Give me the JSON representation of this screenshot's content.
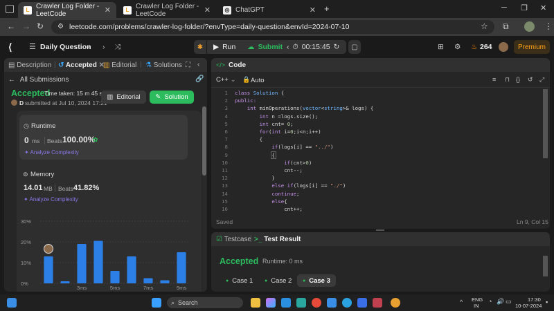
{
  "browser": {
    "tabs": [
      {
        "label": "Crawler Log Folder - LeetCode",
        "active": true
      },
      {
        "label": "Crawler Log Folder - LeetCode",
        "active": false
      },
      {
        "label": "ChatGPT",
        "active": false
      }
    ],
    "url": "leetcode.com/problems/crawler-log-folder/?envType=daily-question&envId=2024-07-10"
  },
  "header": {
    "daily_question": "Daily Question",
    "run": "Run",
    "submit": "Submit",
    "timer": "00:15:45",
    "streak": "264",
    "premium": "Premium"
  },
  "left_panel": {
    "tabs": [
      "Description",
      "Accepted",
      "Editorial",
      "Solutions"
    ],
    "all_submissions": "All Submissions",
    "status": "Accepted",
    "time_taken": "Time taken: 15 m 45 s",
    "user": "D",
    "submitted": "submitted at Jul 10, 2024 17:21",
    "editorial_btn": "Editorial",
    "solution_btn": "Solution",
    "runtime": {
      "title": "Runtime",
      "value": "0",
      "unit": "ms",
      "beats_label": "Beats",
      "beats_value": "100.00%",
      "analyze": "Analyze Complexity"
    },
    "memory": {
      "title": "Memory",
      "value": "14.01",
      "unit": "MB",
      "beats_label": "Beats",
      "beats_value": "41.82%",
      "analyze": "Analyze Complexity"
    }
  },
  "chart_data": {
    "type": "bar",
    "ytick_labels": [
      "30%",
      "20%",
      "10%",
      "0%"
    ],
    "ylim": [
      0,
      30
    ],
    "xtick_labels": [
      "3ms",
      "5ms",
      "7ms",
      "9ms"
    ],
    "values": [
      13,
      1,
      19,
      20.5,
      6,
      13,
      2.5,
      1.5,
      15
    ]
  },
  "code_panel": {
    "title": "Code",
    "language": "C++",
    "mode": "Auto",
    "saved": "Saved",
    "cursor": "Ln 9, Col 15",
    "lines": [
      "class Solution {",
      "public:",
      "    int minOperations(vector<string>& logs) {",
      "        int n =logs.size();",
      "        int cnt= 0;",
      "        for(int i=0;i<n;i++)",
      "        {",
      "            if(logs[i] == \"../\")",
      "            {",
      "                if(cnt>0)",
      "                cnt--;",
      "            }",
      "            else if(logs[i] == \"./\")",
      "            continue;",
      "            else{",
      "                cnt++;"
    ]
  },
  "test_panel": {
    "testcase": "Testcase",
    "test_result": "Test Result",
    "accepted": "Accepted",
    "runtime": "Runtime: 0 ms",
    "cases": [
      "Case 1",
      "Case 2",
      "Case 3"
    ]
  },
  "taskbar": {
    "search": "Search",
    "lang_top": "ENG",
    "lang_bottom": "IN",
    "time": "17:30",
    "date": "10-07-2024"
  }
}
